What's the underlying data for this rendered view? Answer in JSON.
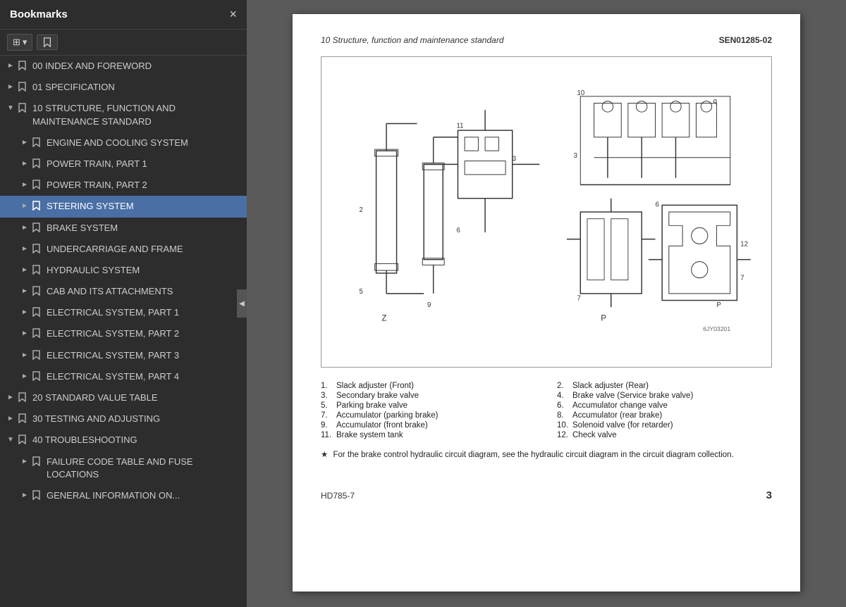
{
  "sidebar": {
    "title": "Bookmarks",
    "close_label": "×",
    "toolbar": {
      "view_btn": "⊞",
      "view_dropdown": "▾",
      "bookmark_btn": "🔖"
    },
    "items": [
      {
        "id": "item-00",
        "level": 0,
        "arrow": "collapsed",
        "label": "00 INDEX AND FOREWORD",
        "active": false
      },
      {
        "id": "item-01",
        "level": 0,
        "arrow": "collapsed",
        "label": "01 SPECIFICATION",
        "active": false
      },
      {
        "id": "item-10",
        "level": 0,
        "arrow": "expanded",
        "label": "10 STRUCTURE, FUNCTION AND MAINTENANCE STANDARD",
        "active": false
      },
      {
        "id": "item-engine",
        "level": 1,
        "arrow": "collapsed",
        "label": "ENGINE AND COOLING SYSTEM",
        "active": false
      },
      {
        "id": "item-power1",
        "level": 1,
        "arrow": "collapsed",
        "label": "POWER TRAIN, PART 1",
        "active": false
      },
      {
        "id": "item-power2",
        "level": 1,
        "arrow": "collapsed",
        "label": "POWER TRAIN, PART 2",
        "active": false
      },
      {
        "id": "item-steering",
        "level": 1,
        "arrow": "collapsed",
        "label": "STEERING SYSTEM",
        "active": true
      },
      {
        "id": "item-brake",
        "level": 1,
        "arrow": "collapsed",
        "label": "BRAKE SYSTEM",
        "active": false
      },
      {
        "id": "item-undercarriage",
        "level": 1,
        "arrow": "collapsed",
        "label": "UNDERCARRIAGE AND FRAME",
        "active": false
      },
      {
        "id": "item-hydraulic",
        "level": 1,
        "arrow": "collapsed",
        "label": "HYDRAULIC SYSTEM",
        "active": false
      },
      {
        "id": "item-cab",
        "level": 1,
        "arrow": "collapsed",
        "label": "CAB AND ITS ATTACHMENTS",
        "active": false
      },
      {
        "id": "item-elec1",
        "level": 1,
        "arrow": "collapsed",
        "label": "ELECTRICAL SYSTEM, PART 1",
        "active": false
      },
      {
        "id": "item-elec2",
        "level": 1,
        "arrow": "collapsed",
        "label": "ELECTRICAL SYSTEM, PART 2",
        "active": false
      },
      {
        "id": "item-elec3",
        "level": 1,
        "arrow": "collapsed",
        "label": "ELECTRICAL SYSTEM, PART 3",
        "active": false
      },
      {
        "id": "item-elec4",
        "level": 1,
        "arrow": "collapsed",
        "label": "ELECTRICAL SYSTEM, PART 4",
        "active": false
      },
      {
        "id": "item-20",
        "level": 0,
        "arrow": "collapsed",
        "label": "20 STANDARD VALUE TABLE",
        "active": false
      },
      {
        "id": "item-30",
        "level": 0,
        "arrow": "collapsed",
        "label": "30 TESTING AND ADJUSTING",
        "active": false
      },
      {
        "id": "item-40",
        "level": 0,
        "arrow": "expanded",
        "label": "40 TROUBLESHOOTING",
        "active": false
      },
      {
        "id": "item-failure",
        "level": 1,
        "arrow": "collapsed",
        "label": "FAILURE CODE TABLE AND FUSE LOCATIONS",
        "active": false
      },
      {
        "id": "item-general",
        "level": 1,
        "arrow": "collapsed",
        "label": "GENERAL INFORMATION ON...",
        "active": false
      }
    ]
  },
  "document": {
    "header_left": "10 Structure, function and maintenance standard",
    "header_right": "SEN01285-02",
    "legend": [
      {
        "num": "1.",
        "text": "Slack adjuster (Front)"
      },
      {
        "num": "2.",
        "text": "Slack adjuster (Rear)"
      },
      {
        "num": "3.",
        "text": "Secondary brake valve"
      },
      {
        "num": "4.",
        "text": "Brake valve (Service brake valve)"
      },
      {
        "num": "5.",
        "text": "Parking brake valve"
      },
      {
        "num": "6.",
        "text": "Accumulator change valve"
      },
      {
        "num": "7.",
        "text": "Accumulator (parking brake)"
      },
      {
        "num": "8.",
        "text": "Accumulator (rear brake)"
      },
      {
        "num": "9.",
        "text": "Accumulator (front brake)"
      },
      {
        "num": "10.",
        "text": "Solenoid valve (for retarder)"
      },
      {
        "num": "11.",
        "text": "Brake system tank"
      },
      {
        "num": "12.",
        "text": "Check valve"
      }
    ],
    "note": "★  For the brake control hydraulic circuit diagram, see the hydraulic circuit diagram in the circuit diagram collection.",
    "footer_left": "HD785-7",
    "footer_right": "3"
  }
}
